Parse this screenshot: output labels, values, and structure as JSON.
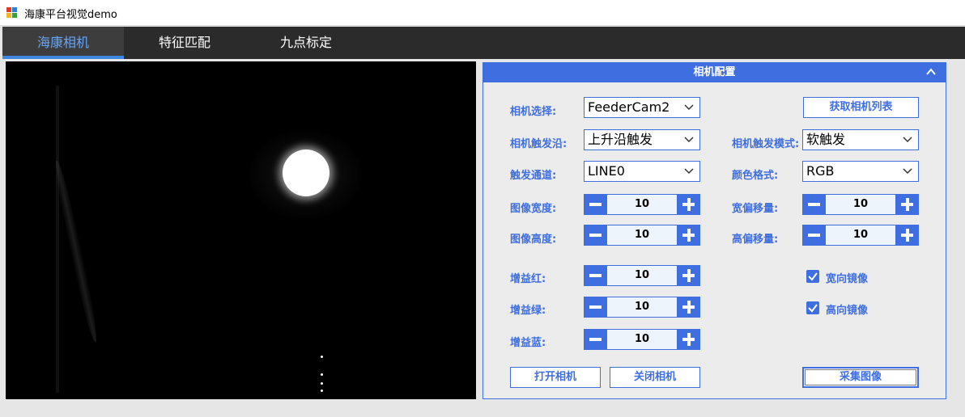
{
  "window": {
    "title": "海康平台视觉demo"
  },
  "tabs": [
    {
      "label": "海康相机",
      "active": true
    },
    {
      "label": "特征匹配",
      "active": false
    },
    {
      "label": "九点标定",
      "active": false
    }
  ],
  "panel": {
    "title": "相机配置",
    "camera_select": {
      "label": "相机选择:",
      "value": "FeederCam2"
    },
    "get_camera_list_label": "获取相机列表",
    "trigger_edge": {
      "label": "相机触发沿:",
      "value": "上升沿触发"
    },
    "trigger_mode": {
      "label": "相机触发模式:",
      "value": "软触发"
    },
    "trigger_channel": {
      "label": "触发通道:",
      "value": "LINE0"
    },
    "color_format": {
      "label": "颜色格式:",
      "value": "RGB"
    },
    "image_width": {
      "label": "图像宽度:",
      "value": "10"
    },
    "width_offset": {
      "label": "宽偏移量:",
      "value": "10"
    },
    "image_height": {
      "label": "图像高度:",
      "value": "10"
    },
    "height_offset": {
      "label": "高偏移量:",
      "value": "10"
    },
    "gain_red": {
      "label": "增益红:",
      "value": "10"
    },
    "gain_green": {
      "label": "增益绿:",
      "value": "10"
    },
    "gain_blue": {
      "label": "增益蓝:",
      "value": "10"
    },
    "mirror_horizontal": {
      "label": "宽向镜像",
      "checked": true
    },
    "mirror_vertical": {
      "label": "高向镜像",
      "checked": true
    },
    "open_camera_label": "打开相机",
    "close_camera_label": "关闭相机",
    "capture_image_label": "采集图像"
  },
  "colors": {
    "accent": "#3f6ee0",
    "tabbar": "#2b2b2b",
    "active_tab_text": "#6aa4ef"
  },
  "icons": [
    "app-icon",
    "chevron-up-icon",
    "chevron-down-icon",
    "minus-icon",
    "plus-icon",
    "checkmark-icon"
  ]
}
